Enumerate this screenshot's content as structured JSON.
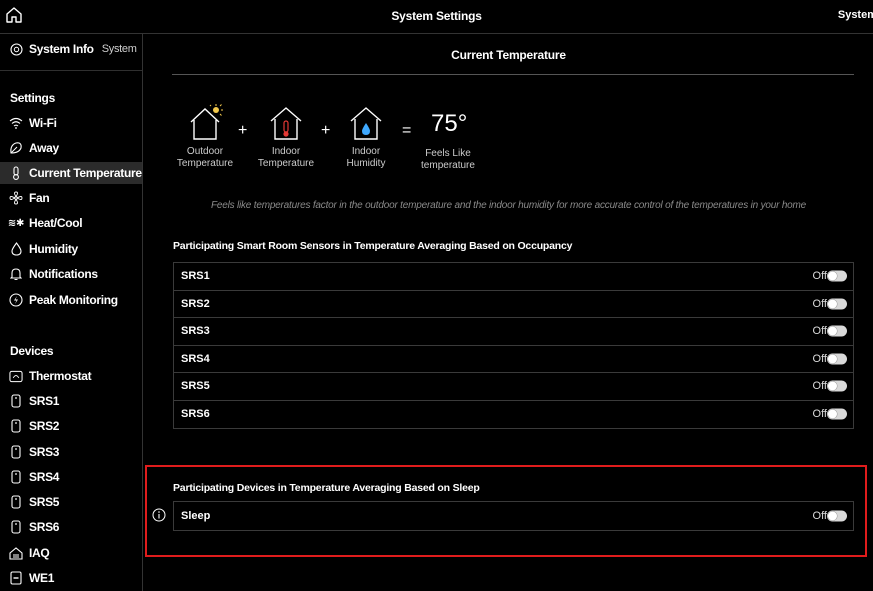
{
  "topbar": {
    "title": "System Settings",
    "right_label": "System"
  },
  "sidebar": {
    "system_info": {
      "label": "System Info",
      "sub": "System"
    },
    "settings_header": "Settings",
    "settings_items": [
      {
        "label": "Wi-Fi",
        "icon": "wifi-icon"
      },
      {
        "label": "Away",
        "icon": "away-icon"
      },
      {
        "label": "Current Temperature",
        "icon": "thermometer-icon",
        "active": true
      },
      {
        "label": "Fan",
        "icon": "fan-icon"
      },
      {
        "label": "Heat/Cool",
        "icon": "heat-cool-icon"
      },
      {
        "label": "Humidity",
        "icon": "humidity-icon"
      },
      {
        "label": "Notifications",
        "icon": "bell-icon"
      },
      {
        "label": "Peak Monitoring",
        "icon": "peak-icon"
      }
    ],
    "devices_header": "Devices",
    "device_items": [
      {
        "label": "Thermostat",
        "icon": "thermostat-icon"
      },
      {
        "label": "SRS1",
        "icon": "sensor-icon"
      },
      {
        "label": "SRS2",
        "icon": "sensor-icon"
      },
      {
        "label": "SRS3",
        "icon": "sensor-icon"
      },
      {
        "label": "SRS4",
        "icon": "sensor-icon"
      },
      {
        "label": "SRS5",
        "icon": "sensor-icon"
      },
      {
        "label": "SRS6",
        "icon": "sensor-icon"
      },
      {
        "label": "IAQ",
        "icon": "iaq-icon"
      },
      {
        "label": "WE1",
        "icon": "we1-icon"
      }
    ]
  },
  "main": {
    "title": "Current Temperature",
    "formula": {
      "outdoor": "Outdoor\nTemperature",
      "indoor_temp": "Indoor\nTemperature",
      "indoor_humidity": "Indoor\nHumidity",
      "feels_like": "Feels Like\ntemperature",
      "plus": "+",
      "equals": "=",
      "value": "75°"
    },
    "note": "Feels like temperatures factor in the outdoor temperature and the indoor humidity for more accurate control of the temperatures in your home",
    "occupancy_section": {
      "title": "Participating Smart Room Sensors in Temperature Averaging Based on Occupancy",
      "rows": [
        {
          "label": "SRS1",
          "state": "Off"
        },
        {
          "label": "SRS2",
          "state": "Off"
        },
        {
          "label": "SRS3",
          "state": "Off"
        },
        {
          "label": "SRS4",
          "state": "Off"
        },
        {
          "label": "SRS5",
          "state": "Off"
        },
        {
          "label": "SRS6",
          "state": "Off"
        }
      ]
    },
    "sleep_section": {
      "title": "Participating Devices in Temperature Averaging Based on Sleep",
      "rows": [
        {
          "label": "Sleep",
          "state": "Off"
        }
      ]
    }
  },
  "colors": {
    "background": "#000000",
    "highlight": "#e01c1c",
    "accent_humidity": "#3fa9ff",
    "accent_sun": "#f2c94c",
    "accent_thermo": "#e53935"
  }
}
